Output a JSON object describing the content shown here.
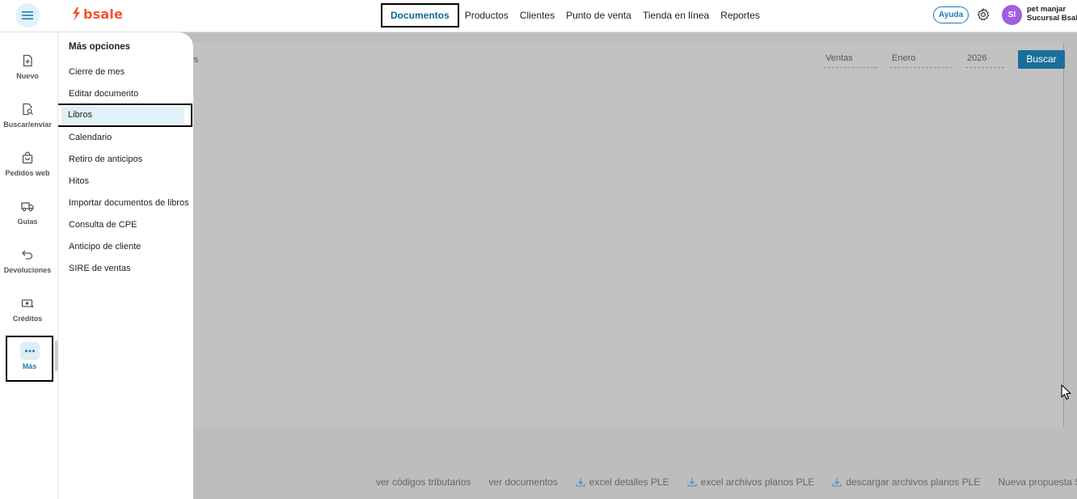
{
  "brand": {
    "name": "bsale",
    "color": "#f2542d"
  },
  "topnav": [
    {
      "label": "Documentos",
      "active": true
    },
    {
      "label": "Productos"
    },
    {
      "label": "Clientes"
    },
    {
      "label": "Punto de venta"
    },
    {
      "label": "Tienda en línea"
    },
    {
      "label": "Reportes"
    }
  ],
  "header": {
    "help_label": "Ayuda",
    "avatar_initials": "SI",
    "user_name": "pet manjar",
    "user_branch": "Sucursal Bsal."
  },
  "sidebar": {
    "items": [
      {
        "label": "Nuevo",
        "icon": "file-plus-icon"
      },
      {
        "label": "Buscar/enviar",
        "icon": "file-search-icon"
      },
      {
        "label": "Pedidos web",
        "icon": "shopping-bag-icon"
      },
      {
        "label": "Guías",
        "icon": "truck-icon"
      },
      {
        "label": "Devoluciones",
        "icon": "return-arrow-icon"
      },
      {
        "label": "Créditos",
        "icon": "money-icon"
      },
      {
        "label": "Más",
        "icon": "more-dots-icon",
        "active": true
      }
    ]
  },
  "more_panel": {
    "title": "Más opciones",
    "items": [
      "Cierre de mes",
      "Editar documento",
      "Libros",
      "Calendario",
      "Retiro de anticipos",
      "Hitos",
      "Importar documentos de libros",
      "Consulta de CPE",
      "Anticipo de cliente",
      "SIRE de ventas"
    ],
    "selected": "Libros"
  },
  "main": {
    "title_fragment": "s",
    "filters": {
      "type": "Ventas",
      "month": "Enero",
      "year": "2026"
    },
    "search_label": "Buscar",
    "footer_links": [
      {
        "label": "ver códigos tributarios",
        "icon": null
      },
      {
        "label": "ver documentos",
        "icon": null
      },
      {
        "label": "excel detalles PLE",
        "icon": "download-icon"
      },
      {
        "label": "excel archivos planos PLE",
        "icon": "download-icon"
      },
      {
        "label": "descargar archivos planos PLE",
        "icon": "download-icon"
      },
      {
        "label": "Nueva propuesta SIRE",
        "icon": null
      }
    ]
  },
  "colors": {
    "accent": "#1a7fb0",
    "primary_button": "#1a6f9a",
    "overlay": "#bdbdbd"
  }
}
